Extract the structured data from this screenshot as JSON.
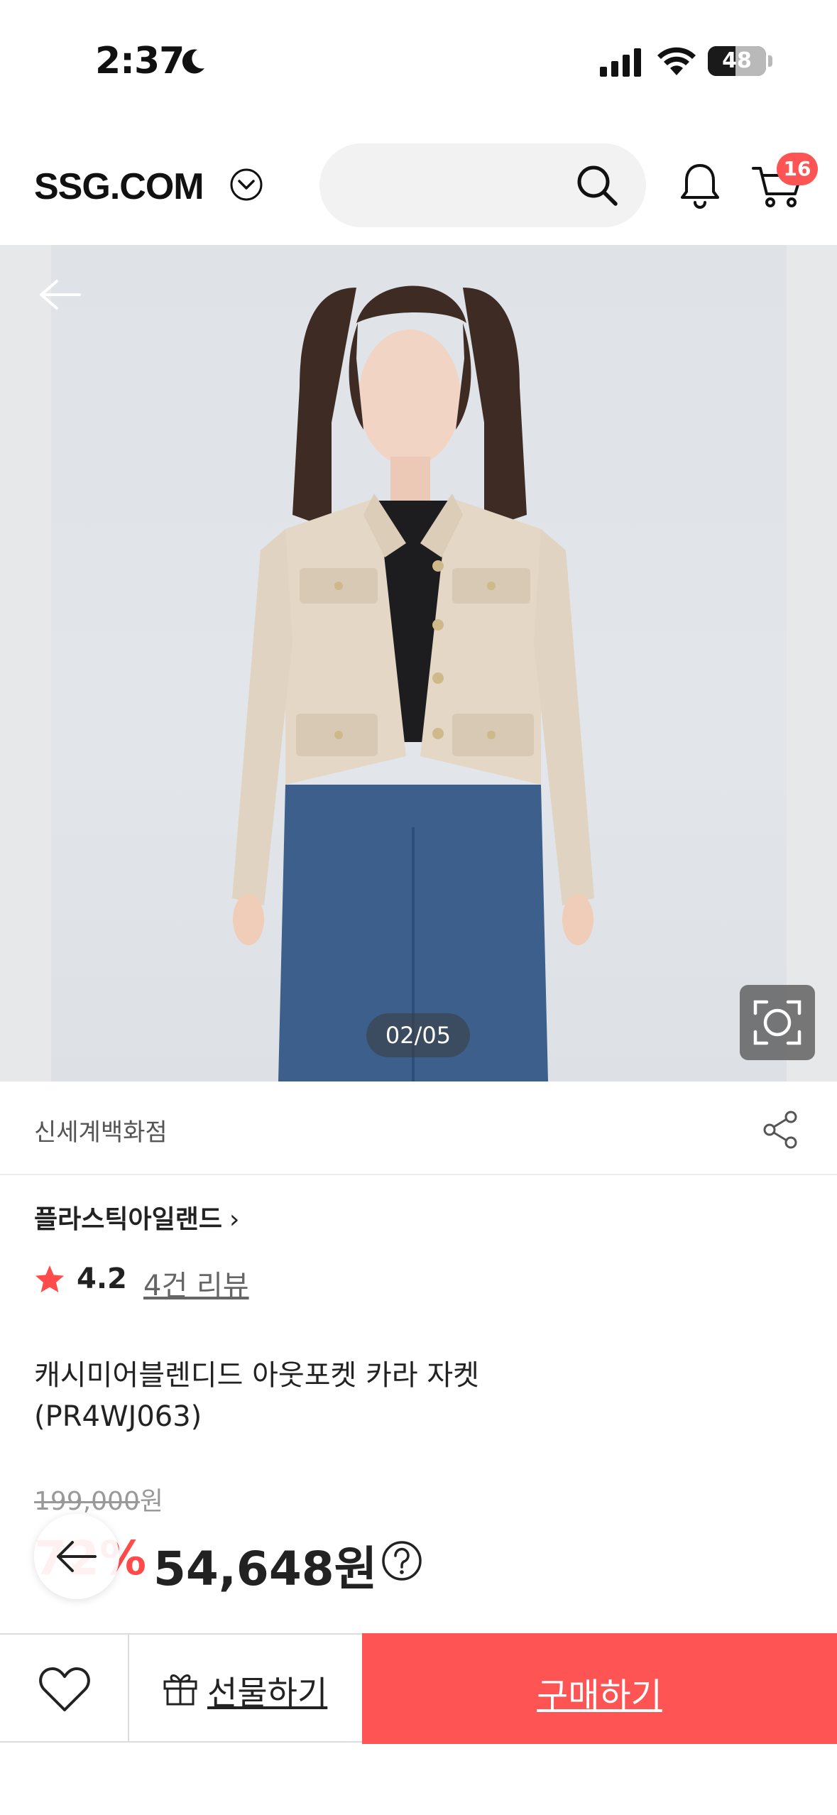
{
  "status_bar": {
    "time": "2:37",
    "battery": "48",
    "battery_level_percent": 48
  },
  "header": {
    "logo": "SSG.COM",
    "cart_count": "16"
  },
  "gallery": {
    "page_indicator": "02/05"
  },
  "store": {
    "name": "신세계백화점"
  },
  "brand": {
    "name": "플라스틱아일랜드",
    "chevron": "›"
  },
  "rating": {
    "value": "4.2",
    "reviews": "4건 리뷰"
  },
  "product": {
    "title_line1": "캐시미어블렌디드 아웃포켓 카라 자켓",
    "title_line2": "(PR4WJ063)"
  },
  "price": {
    "original": "199,000",
    "original_unit": "원",
    "discount": "72%",
    "sale": "54,648원"
  },
  "actions": {
    "gift_label": "선물하기",
    "buy_label": "구매하기"
  },
  "colors": {
    "accent": "#ff5454",
    "discount": "#ff4b4b",
    "star": "#ff4b4b"
  },
  "icons": [
    "moon-icon",
    "cellular-signal-icon",
    "wifi-icon",
    "battery-icon",
    "chevron-down-icon",
    "search-icon",
    "bell-icon",
    "cart-icon",
    "back-arrow-icon",
    "camera-lens-icon",
    "share-icon",
    "star-icon",
    "help-icon",
    "heart-icon",
    "gift-icon"
  ]
}
